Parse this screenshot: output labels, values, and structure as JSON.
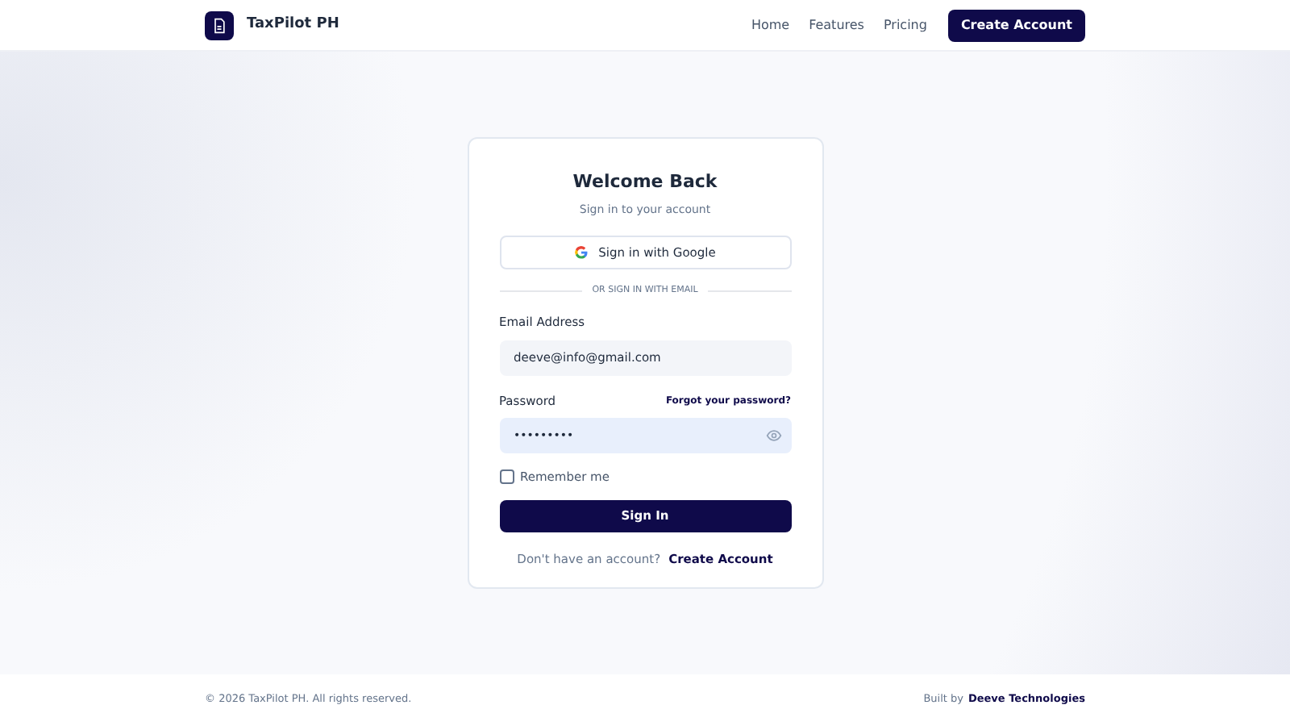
{
  "header": {
    "brand": "TaxPilot PH",
    "nav": [
      "Home",
      "Features",
      "Pricing"
    ],
    "cta": "Create Account"
  },
  "login": {
    "title": "Welcome Back",
    "subtitle": "Sign in to your account",
    "google_button": "Sign in with Google",
    "divider": "OR SIGN IN WITH EMAIL",
    "email": {
      "label": "Email Address",
      "value": "deeve@info@gmail.com"
    },
    "password": {
      "label": "Password",
      "forgot_link": "Forgot your password?",
      "value": "•••••••••"
    },
    "remember": {
      "label": "Remember me",
      "checked": false
    },
    "submit": "Sign In",
    "signup_prompt": "Don't have an account?",
    "signup_link": "Create Account"
  },
  "footer": {
    "copyright": "© 2026 TaxPilot PH. All rights reserved.",
    "built_by": "Built by",
    "company": "Deeve Technologies"
  }
}
